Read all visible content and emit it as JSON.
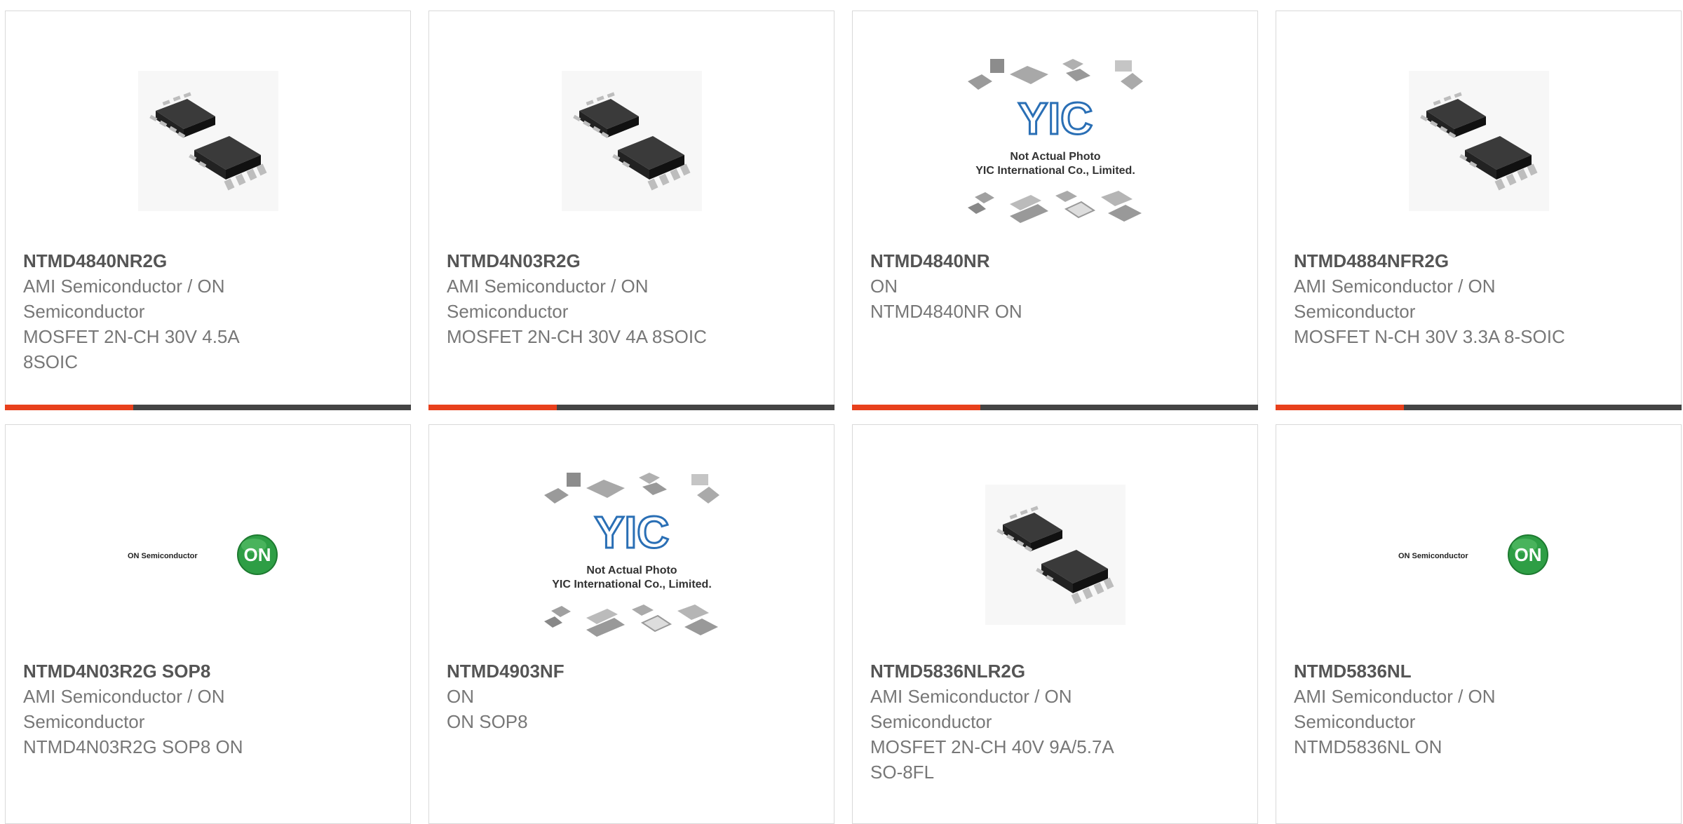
{
  "products": [
    {
      "part": "NTMD4840NR2G",
      "brand": "AMI Semiconductor / ON Semiconductor",
      "desc": "MOSFET 2N-CH 30V 4.5A 8SOIC",
      "image": "chip-icon"
    },
    {
      "part": "NTMD4N03R2G",
      "brand": "AMI Semiconductor / ON Semiconductor",
      "desc": "MOSFET 2N-CH 30V 4A 8SOIC",
      "image": "chip-icon"
    },
    {
      "part": "NTMD4840NR",
      "brand": "ON",
      "desc": "NTMD4840NR ON",
      "image": "not-actual-photo-icon"
    },
    {
      "part": "NTMD4884NFR2G",
      "brand": "AMI Semiconductor / ON Semiconductor",
      "desc": "MOSFET N-CH 30V 3.3A 8-SOIC",
      "image": "chip-icon"
    },
    {
      "part": "NTMD4N03R2G SOP8",
      "brand": "AMI Semiconductor / ON Semiconductor",
      "desc": "NTMD4N03R2G SOP8 ON",
      "image": "on-semi-logo-icon"
    },
    {
      "part": "NTMD4903NF",
      "brand": "ON",
      "desc": "ON SOP8",
      "image": "not-actual-photo-icon"
    },
    {
      "part": "NTMD5836NLR2G",
      "brand": "AMI Semiconductor / ON Semiconductor",
      "desc": "MOSFET 2N-CH 40V 9A/5.7A SO-8FL",
      "image": "chip-icon"
    },
    {
      "part": "NTMD5836NL",
      "brand": "AMI Semiconductor / ON Semiconductor",
      "desc": "NTMD5836NL ON",
      "image": "on-semi-logo-icon"
    }
  ],
  "placeholder_image": {
    "logo_text": "YIC",
    "line1": "Not Actual Photo",
    "line2": "YIC International Co., Limited."
  },
  "on_logo": {
    "wordmark": "ON Semiconductor",
    "badge": "ON"
  },
  "colors": {
    "accent": "#e8401c",
    "bar": "#444444",
    "part_text": "#555555",
    "body_text": "#777777",
    "border": "#d9d9d9",
    "on_green": "#2e9e45",
    "yic_blue": "#2a6fb5"
  }
}
